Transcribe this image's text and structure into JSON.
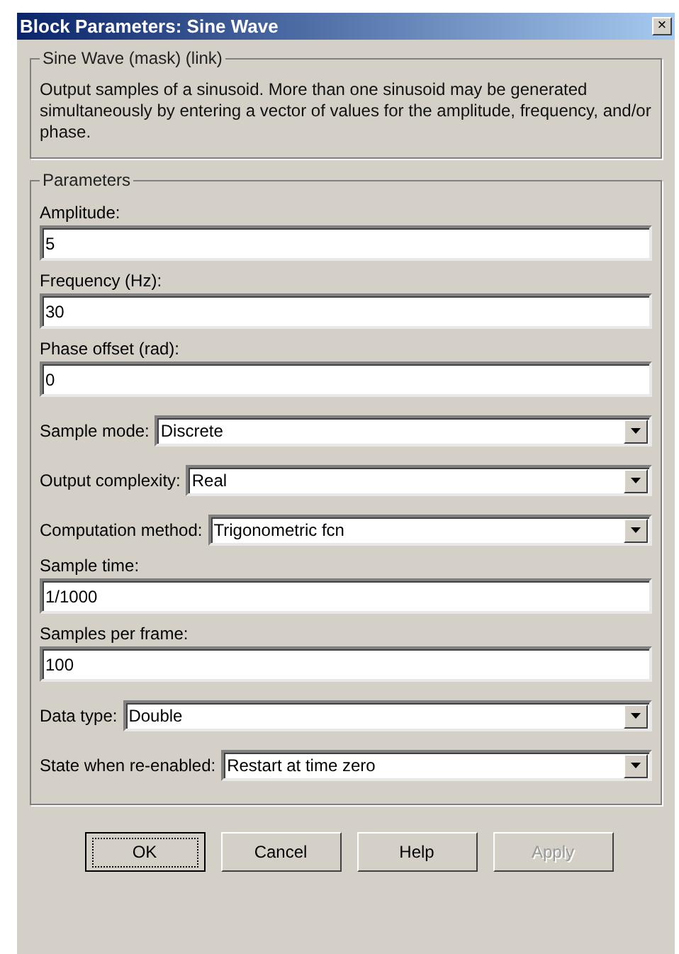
{
  "window": {
    "title": "Block Parameters: Sine Wave",
    "close": "×"
  },
  "description": {
    "title": "Sine Wave (mask) (link)",
    "text": "Output samples of a sinusoid.  More than one sinusoid may be generated simultaneously by entering a vector of values for the amplitude, frequency, and/or phase."
  },
  "parameters": {
    "title": "Parameters",
    "items": [
      {
        "kind": "text",
        "label": "Amplitude:",
        "value": "5"
      },
      {
        "kind": "text",
        "label": "Frequency (Hz):",
        "value": "30"
      },
      {
        "kind": "text",
        "label": "Phase offset (rad):",
        "value": "0"
      },
      {
        "kind": "dropdown",
        "label": "Sample mode:",
        "value": "Discrete"
      },
      {
        "kind": "dropdown",
        "label": "Output complexity:",
        "value": "Real"
      },
      {
        "kind": "dropdown",
        "label": "Computation method:",
        "value": "Trigonometric fcn"
      },
      {
        "kind": "text",
        "label": "Sample time:",
        "value": "1/1000"
      },
      {
        "kind": "text",
        "label": "Samples per frame:",
        "value": "100"
      },
      {
        "kind": "dropdown",
        "label": "Data type:",
        "value": "Double"
      },
      {
        "kind": "dropdown",
        "label": "State when re-enabled:",
        "value": "Restart at time zero"
      }
    ]
  },
  "buttons": [
    {
      "label": "OK",
      "focused": true,
      "disabled": false
    },
    {
      "label": "Cancel",
      "focused": false,
      "disabled": false
    },
    {
      "label": "Help",
      "focused": false,
      "disabled": false
    },
    {
      "label": "Apply",
      "focused": false,
      "disabled": true
    }
  ]
}
